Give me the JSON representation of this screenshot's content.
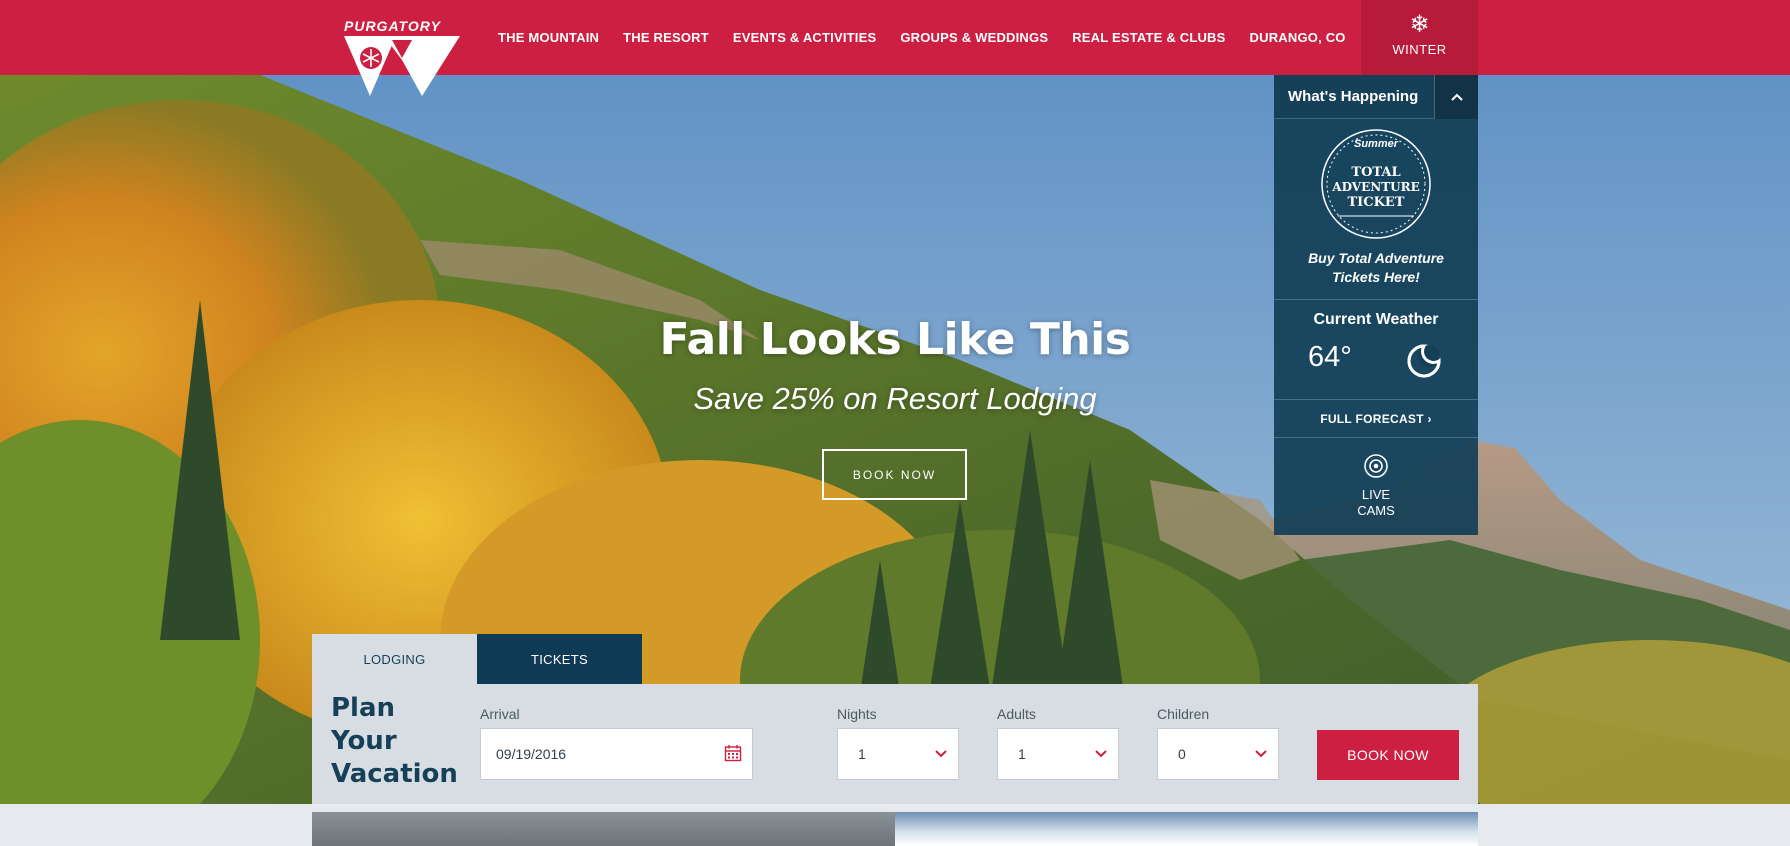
{
  "brand": {
    "logo_text": "PURGATORY"
  },
  "nav": {
    "items": [
      {
        "label": "THE MOUNTAIN"
      },
      {
        "label": "THE RESORT"
      },
      {
        "label": "EVENTS & ACTIVITIES"
      },
      {
        "label": "GROUPS & WEDDINGS"
      },
      {
        "label": "REAL ESTATE & CLUBS"
      },
      {
        "label": "DURANGO, CO"
      }
    ],
    "season": {
      "icon": "snowflake-icon",
      "label": "WINTER"
    }
  },
  "hero": {
    "title": "Fall Looks Like This",
    "subtitle": "Save 25% on Resort Lodging",
    "cta": "BOOK NOW"
  },
  "whats_happening": {
    "title": "What's Happening",
    "toggle_icon": "chevron-up-icon",
    "badge": {
      "top_word": "Summer",
      "lines": [
        "TOTAL",
        "ADVENTURE",
        "TICKET"
      ]
    },
    "promo_line1": "Buy Total Adventure",
    "promo_line2": "Tickets Here!",
    "weather_title": "Current Weather",
    "temperature": "64°",
    "weather_icon": "moon-icon",
    "forecast_link": "FULL FORECAST",
    "cams_line1": "LIVE",
    "cams_line2": "CAMS"
  },
  "booking": {
    "tabs": [
      {
        "label": "LODGING",
        "active": true
      },
      {
        "label": "TICKETS",
        "active": false
      }
    ],
    "heading": [
      "Plan",
      "Your",
      "Vacation"
    ],
    "arrival": {
      "label": "Arrival",
      "value": "09/19/2016"
    },
    "nights": {
      "label": "Nights",
      "value": "1"
    },
    "adults": {
      "label": "Adults",
      "value": "1"
    },
    "children": {
      "label": "Children",
      "value": "0"
    },
    "submit": "BOOK NOW"
  },
  "colors": {
    "brand_red": "#cd1f42",
    "navy": "#163f58",
    "panel_bg": "#d7dde3"
  }
}
